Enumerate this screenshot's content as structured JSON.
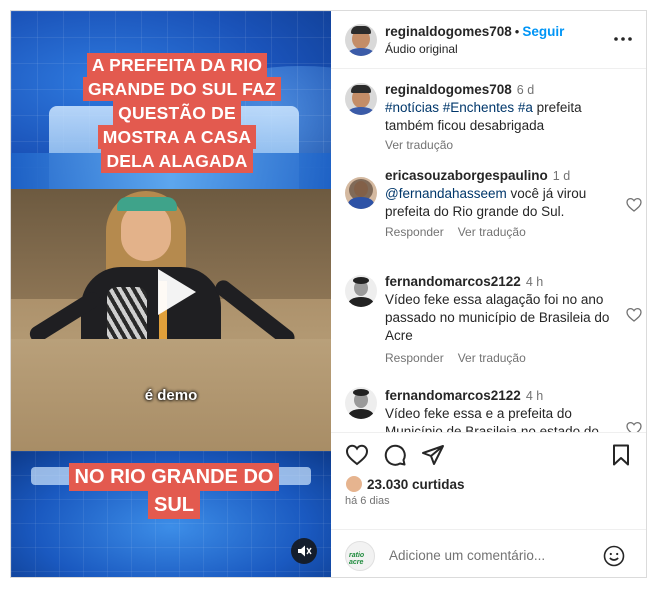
{
  "video": {
    "caption_top": [
      "A PREFEITA DA RIO",
      "GRANDE DO SUL FAZ",
      "QUESTÃO DE",
      "MOSTRA A CASA",
      "DELA ALAGADA"
    ],
    "subtitle": "é demo",
    "caption_bottom": [
      "NO RIO GRANDE DO",
      "SUL"
    ]
  },
  "header": {
    "username": "reginaldogomes708",
    "follow_label": "Seguir",
    "audio": "Áudio original"
  },
  "comments": [
    {
      "username": "reginaldogomes708",
      "time": "6 d",
      "lines": [
        [
          {
            "t": "#notícias #Enchentes #a",
            "tag": true
          },
          {
            "t": " prefeita",
            "tag": false
          }
        ],
        [
          {
            "t": "também ficou desabrigada",
            "tag": false
          }
        ]
      ],
      "actions": [
        "Ver tradução"
      ]
    },
    {
      "username": "ericasouzaborgespaulino",
      "time": "1 d",
      "lines": [
        [
          {
            "t": "@fernandahasseem",
            "tag": true
          },
          {
            "t": " você já virou",
            "tag": false
          }
        ],
        [
          {
            "t": "prefeita do Rio grande do Sul.",
            "tag": false
          }
        ]
      ],
      "actions": [
        "Responder",
        "Ver tradução"
      ]
    },
    {
      "username": "fernandomarcos2122",
      "time": "4 h",
      "lines": [
        [
          {
            "t": "Vídeo feke essa alagação foi no ano",
            "tag": false
          }
        ],
        [
          {
            "t": "passado no município de Brasileia do",
            "tag": false
          }
        ],
        [
          {
            "t": "Acre",
            "tag": false
          }
        ]
      ],
      "actions": [
        "Responder",
        "Ver tradução"
      ]
    },
    {
      "username": "fernandomarcos2122",
      "time": "4 h",
      "lines": [
        [
          {
            "t": "Vídeo feke essa e a prefeita do",
            "tag": false
          }
        ],
        [
          {
            "t": "Município de Brasileia no estado do",
            "tag": false
          }
        ]
      ],
      "actions": []
    }
  ],
  "likes": "23.030 curtidas",
  "posted_ago": "há 6 dias",
  "add_comment": {
    "placeholder": "Adicione um comentário...",
    "logo_text": "ratio acre"
  },
  "colors": {
    "link_blue": "#0095f6",
    "hashtag": "#00376b",
    "caption_red": "#e35a4f",
    "muted_text": "#737373"
  },
  "icons": [
    "more-icon",
    "heart-icon",
    "comment-icon",
    "share-icon",
    "bookmark-icon",
    "emoji-icon",
    "mute-icon",
    "play-icon"
  ]
}
